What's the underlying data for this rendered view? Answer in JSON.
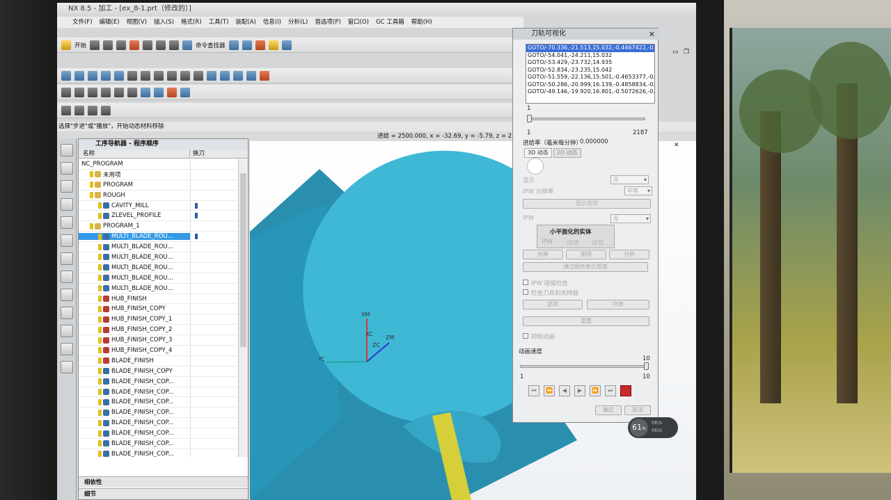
{
  "app": {
    "title": "NX 8.5 - 加工 - [ex_8-1.prt（修改的）]"
  },
  "menubar": {
    "items": [
      "文件(F)",
      "编辑(E)",
      "视图(V)",
      "插入(S)",
      "格式(R)",
      "工具(T)",
      "装配(A)",
      "信息(I)",
      "分析(L)",
      "首选项(P)",
      "窗口(O)",
      "GC 工具箱",
      "帮助(H)"
    ]
  },
  "toolbar": {
    "start_label": "开始",
    "command_finder_label": "命令查找器"
  },
  "status": {
    "prompt": "选择\"步进\"或\"播放\"，开始动态材料移除",
    "coords": "进给 = 2500.000, x = -32.69, y = -5.79, z = 28."
  },
  "navigator": {
    "title": "工序导航器 - 程序顺序",
    "col_name": "名称",
    "col_toolchange": "换刀",
    "rows": [
      {
        "label": "NC_PROGRAM",
        "indent": 0,
        "icon": "none",
        "tool": false,
        "sel": false
      },
      {
        "label": "未用项",
        "indent": 1,
        "icon": "fold",
        "tool": false,
        "sel": false
      },
      {
        "label": "PROGRAM",
        "indent": 1,
        "icon": "fold",
        "tool": false,
        "sel": false
      },
      {
        "label": "ROUGH",
        "indent": 1,
        "icon": "fold",
        "tool": false,
        "sel": false
      },
      {
        "label": "CAVITY_MILL",
        "indent": 2,
        "icon": "blue",
        "tool": true,
        "sel": false
      },
      {
        "label": "ZLEVEL_PROFILE",
        "indent": 2,
        "icon": "blue",
        "tool": true,
        "sel": false
      },
      {
        "label": "PROGRAM_1",
        "indent": 1,
        "icon": "fold",
        "tool": false,
        "sel": false
      },
      {
        "label": "MULTI_BLADE_ROU...",
        "indent": 2,
        "icon": "blue",
        "tool": true,
        "sel": true
      },
      {
        "label": "MULTI_BLADE_ROU...",
        "indent": 2,
        "icon": "blue",
        "tool": false,
        "sel": false
      },
      {
        "label": "MULTI_BLADE_ROU...",
        "indent": 2,
        "icon": "blue",
        "tool": false,
        "sel": false
      },
      {
        "label": "MULTI_BLADE_ROU...",
        "indent": 2,
        "icon": "blue",
        "tool": false,
        "sel": false
      },
      {
        "label": "MULTI_BLADE_ROU...",
        "indent": 2,
        "icon": "blue",
        "tool": false,
        "sel": false
      },
      {
        "label": "MULTI_BLADE_ROU...",
        "indent": 2,
        "icon": "blue",
        "tool": false,
        "sel": false
      },
      {
        "label": "HUB_FINISH",
        "indent": 2,
        "icon": "red",
        "tool": false,
        "sel": false
      },
      {
        "label": "HUB_FINISH_COPY",
        "indent": 2,
        "icon": "red",
        "tool": false,
        "sel": false
      },
      {
        "label": "HUB_FINISH_COPY_1",
        "indent": 2,
        "icon": "red",
        "tool": false,
        "sel": false
      },
      {
        "label": "HUB_FINISH_COPY_2",
        "indent": 2,
        "icon": "red",
        "tool": false,
        "sel": false
      },
      {
        "label": "HUB_FINISH_COPY_3",
        "indent": 2,
        "icon": "red",
        "tool": false,
        "sel": false
      },
      {
        "label": "HUB_FINISH_COPY_4",
        "indent": 2,
        "icon": "red",
        "tool": false,
        "sel": false
      },
      {
        "label": "BLADE_FINISH",
        "indent": 2,
        "icon": "red",
        "tool": false,
        "sel": false
      },
      {
        "label": "BLADE_FINISH_COPY",
        "indent": 2,
        "icon": "blue",
        "tool": false,
        "sel": false
      },
      {
        "label": "BLADE_FINISH_COP...",
        "indent": 2,
        "icon": "blue",
        "tool": false,
        "sel": false
      },
      {
        "label": "BLADE_FINISH_COP...",
        "indent": 2,
        "icon": "blue",
        "tool": false,
        "sel": false
      },
      {
        "label": "BLADE_FINISH_COP...",
        "indent": 2,
        "icon": "blue",
        "tool": false,
        "sel": false
      },
      {
        "label": "BLADE_FINISH_COP...",
        "indent": 2,
        "icon": "blue",
        "tool": false,
        "sel": false
      },
      {
        "label": "BLADE_FINISH_COP...",
        "indent": 2,
        "icon": "blue",
        "tool": false,
        "sel": false
      },
      {
        "label": "BLADE_FINISH_COP...",
        "indent": 2,
        "icon": "blue",
        "tool": false,
        "sel": false
      },
      {
        "label": "BLADE_FINISH_COP...",
        "indent": 2,
        "icon": "blue",
        "tool": false,
        "sel": false
      },
      {
        "label": "BLADE_FINISH_COP...",
        "indent": 2,
        "icon": "blue",
        "tool": false,
        "sel": false
      }
    ],
    "section_dependencies": "相依性",
    "section_details": "细节"
  },
  "viewport": {
    "axis_labels": [
      "XM",
      "YC",
      "ZC",
      "ZM",
      "XC"
    ],
    "part_color": "#3fb8d6",
    "part_shadow": "#2a8fae",
    "tool_color": "#d6cf3a"
  },
  "dialog": {
    "title": "刀轨可视化",
    "goto_lines": [
      "GOTO/-70.336,-21.513,15.032,-0.4467422,-0",
      "GOTO/-54.041,-24.211,15.032",
      "GOTO/-53.429,-23.732,14.935",
      "GOTO/-52.834,-23.235,15.042",
      "GOTO/-51.559,-22.136,15.501,-0.4653377,-0.",
      "GOTO/-50.286,-20.999,16.139,-0.4858834,-0.",
      "GOTO/-49.146,-19.920,16.801,-0.5072626,-0."
    ],
    "slider_min": "1",
    "slider_max": "2187",
    "feedrate_label": "进给率（毫米每分钟）",
    "feedrate_value": "0.000000",
    "tab_3d": "3D 动态",
    "tab_2d": "2D 动态",
    "show_label": "显示",
    "show_value": "无",
    "ipw_resolution_label": "IPW 分辨率",
    "ipw_resolution_value": "中等",
    "display_options": "显示选项",
    "ipw_label": "IPW",
    "ipw_value": "无",
    "subgroup_title": "小平面化的实体",
    "radio_ipw": "IPW",
    "radio_overcut": "过切",
    "radio_gouge": "过切",
    "btn_create": "创建",
    "btn_delete": "删除",
    "btn_analyze": "分析",
    "btn_remove_display": "通过颜色表示厚度",
    "chk_ipw_collision": "IPW 碰撞检查",
    "chk_check_tool": "检查刀具和夹持器",
    "btn_options": "选项",
    "btn_list": "列表",
    "btn_reset": "重置",
    "chk_anim": "抑制动画",
    "speed_label": "动画速度",
    "speed_value": "10",
    "speed_min": "1",
    "speed_max": "10",
    "btn_ok": "确定",
    "btn_cancel": "取消"
  },
  "badge": {
    "percent": "61",
    "unit": "%",
    "up": "0K/s",
    "down": "0K/s"
  }
}
